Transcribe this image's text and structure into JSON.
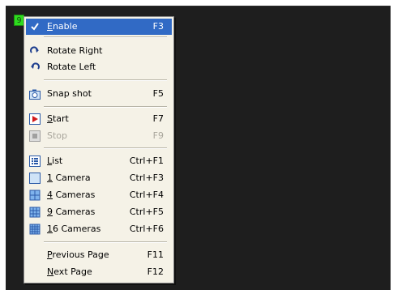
{
  "camera_badge": "9",
  "menu": {
    "enable": {
      "label": "Enable",
      "accel": "F3"
    },
    "rotate_right": {
      "label": "Rotate Right"
    },
    "rotate_left": {
      "label": "Rotate Left"
    },
    "snapshot": {
      "label": "Snap shot",
      "accel": "F5"
    },
    "start": {
      "label": "Start",
      "accel": "F7"
    },
    "stop": {
      "label": "Stop",
      "accel": "F9"
    },
    "list": {
      "label": "List",
      "accel": "Ctrl+F1"
    },
    "cam1": {
      "label": "1 Camera",
      "accel": "Ctrl+F3"
    },
    "cam4": {
      "label": "4 Cameras",
      "accel": "Ctrl+F4"
    },
    "cam9": {
      "label": "9 Cameras",
      "accel": "Ctrl+F5"
    },
    "cam16": {
      "label": "16 Cameras",
      "accel": "Ctrl+F6"
    },
    "prev_page": {
      "label": "Previous Page",
      "accel": "F11"
    },
    "next_page": {
      "label": "Next Page",
      "accel": "F12"
    }
  },
  "icons": {
    "enable": "check-icon",
    "rotate_right": "rotate-right-icon",
    "rotate_left": "rotate-left-icon",
    "snapshot": "camera-icon",
    "start": "play-icon",
    "stop": "stop-icon",
    "list": "list-icon",
    "cam1": "single-view-icon",
    "cam4": "quad-view-icon",
    "cam9": "nine-view-icon",
    "cam16": "sixteen-view-icon"
  },
  "colors": {
    "highlight": "#316ac5",
    "menu_bg": "#f5f2e7",
    "badge": "#2ddc1e",
    "viewport": "#1e1e1e"
  }
}
